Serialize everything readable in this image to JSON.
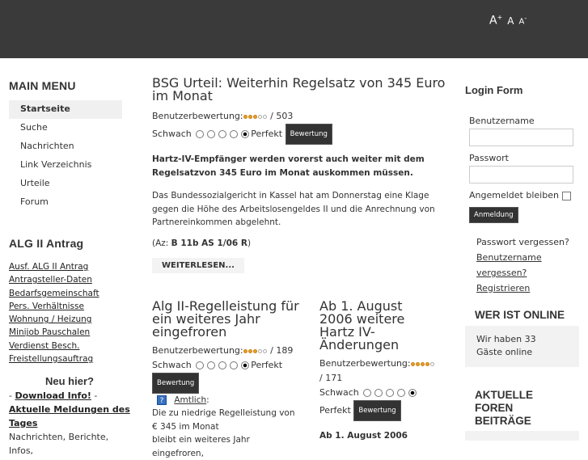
{
  "font_sizer": {
    "bigger": "A",
    "reset": "A",
    "smaller": "A",
    "plus": "+",
    "minus": "-"
  },
  "main_menu": {
    "title": "MAIN MENU",
    "items": [
      "Startseite",
      "Suche",
      "Nachrichten",
      "Link Verzeichnis",
      "Urteile",
      "Forum"
    ]
  },
  "alg": {
    "title": "ALG II Antrag",
    "links": [
      "Ausf. ALG II Antrag",
      "Antragsteller-Daten",
      "Bedarfsgemeinschaft",
      "Pers. Verhältnisse",
      "Wohnung / Heizung",
      "Minijob Pauschalen",
      "Verdienst Besch.",
      "Freistellungsauftrag"
    ]
  },
  "neu": {
    "title": "Neu hier?",
    "dash1": "- ",
    "download": "Download Info!",
    "dash2": " -",
    "aktuelle": "Aktuelle Meldungen des Tages",
    "rest": "Nachrichten, Berichte, Infos,"
  },
  "article1": {
    "title": "BSG Urteil: Weiterhin Regelsatz von 345 Euro im Monat",
    "rating_label": "Benutzerbewertung:",
    "stars": 3,
    "votes": "/ 503",
    "weak": "Schwach",
    "perfect": "Perfekt",
    "vote_button": "Bewertung",
    "lead": "Hartz-IV-Empfänger werden vorerst auch weiter mit dem Regelsatzvon 345 Euro im Monat auskommen müssen.",
    "body": "Das Bundessozialgericht in Kassel hat am Donnerstag eine Klage gegen die Höhe des Arbeitslosengeldes II und die Anrechnung von Partnereinkommen abgelehnt.",
    "az_prefix": "(Az: ",
    "az": "B 11b AS 1/06 R",
    "az_suffix": ")",
    "more": "WEITERLESEN..."
  },
  "article2": {
    "title": "Alg II-Regelleistung für ein weiteres Jahr eingefroren",
    "rating_label": "Benutzerbewertung:",
    "stars": 3,
    "votes": "/ 189",
    "weak": "Schwach",
    "perfect": "Perfekt",
    "vote_button": "Bewertung",
    "amtlich": "Amtlich",
    "colon": ":",
    "body1": "Die zu niedrige Regelleistung von € 345 im Monat",
    "body2": "bleibt ein weiteres Jahr eingefroren,"
  },
  "article3": {
    "title": "Ab 1. August 2006 weitere Hartz IV-Änderungen",
    "rating_label": "Benutzerbewertung:",
    "stars": 4,
    "votes": "/ 171",
    "weak": "Schwach",
    "perfect": "Perfekt",
    "vote_button": "Bewertung",
    "sub": "Ab 1. August 2006"
  },
  "login": {
    "title": "Login Form",
    "user_label": "Benutzername",
    "pass_label": "Passwort",
    "remember": "Angemeldet bleiben",
    "submit": "Anmeldung",
    "forgot_pass": "Passwort vergessen?",
    "forgot_user": "Benutzername vergessen?",
    "register": "Registrieren"
  },
  "online": {
    "title": "WER IST ONLINE",
    "text1": "Wir haben 33",
    "text2": "Gäste online"
  },
  "forum": {
    "title": "AKTUELLE FOREN BEITRÄGE"
  }
}
